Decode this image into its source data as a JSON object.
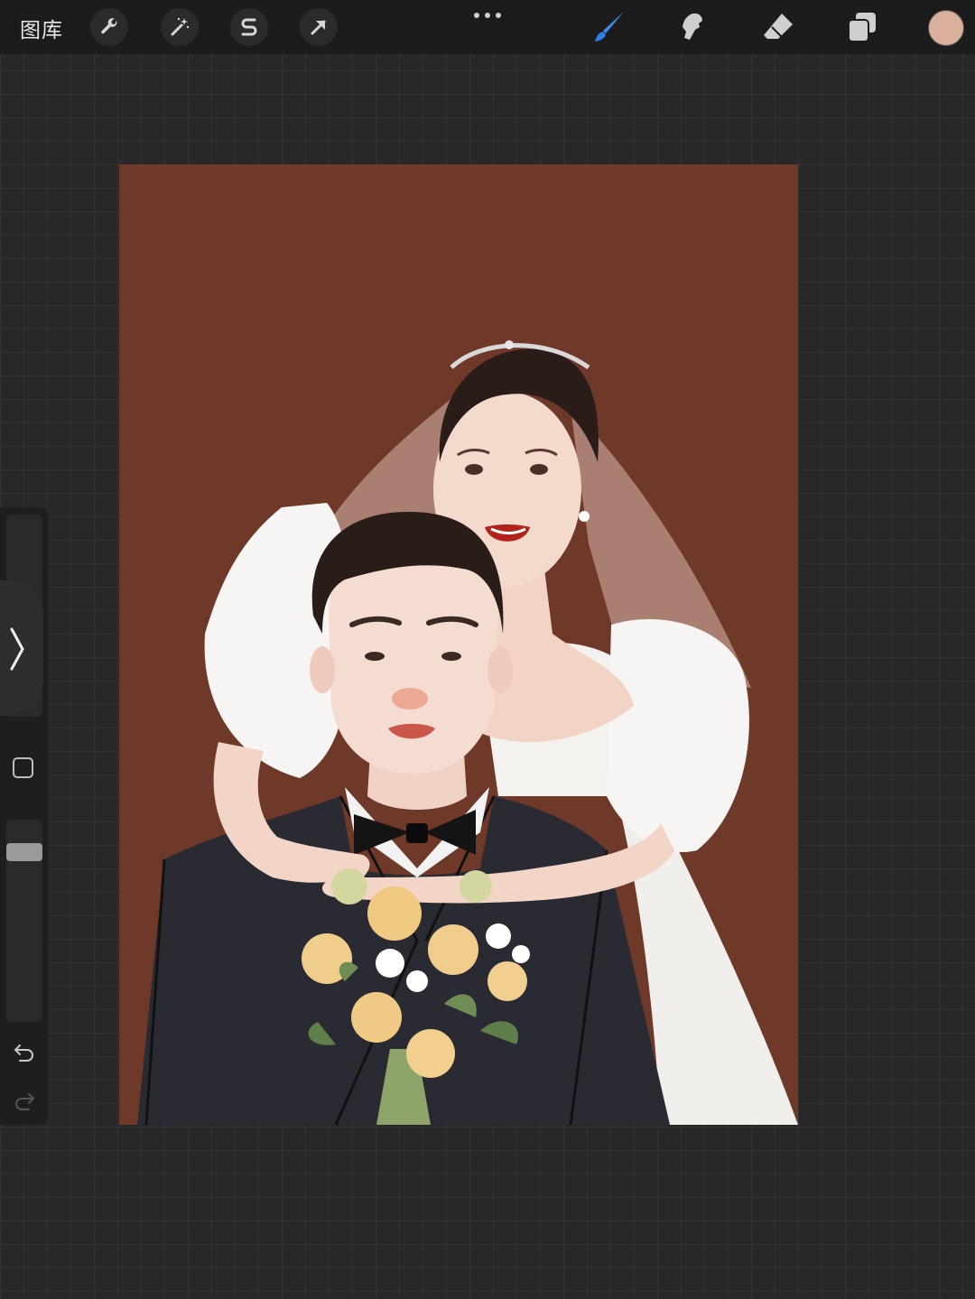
{
  "toolbar": {
    "gallery_label": "图库",
    "left_tools": [
      "wrench-icon",
      "magic-wand-icon",
      "selection-s-icon",
      "move-arrow-icon"
    ],
    "right_tools": [
      "brush-icon",
      "smudge-icon",
      "eraser-icon",
      "layers-icon"
    ],
    "active_tool": "brush-icon",
    "current_color": "#d8b09b",
    "accent_color": "#2f7fe8"
  },
  "sidebar": {
    "brush_size_level": 0.82,
    "opacity_level": 0.15,
    "icons": [
      "modify-square-icon",
      "undo-icon",
      "redo-icon",
      "expand-chevron-icon"
    ]
  },
  "artwork": {
    "background_color": "#6f392a"
  }
}
